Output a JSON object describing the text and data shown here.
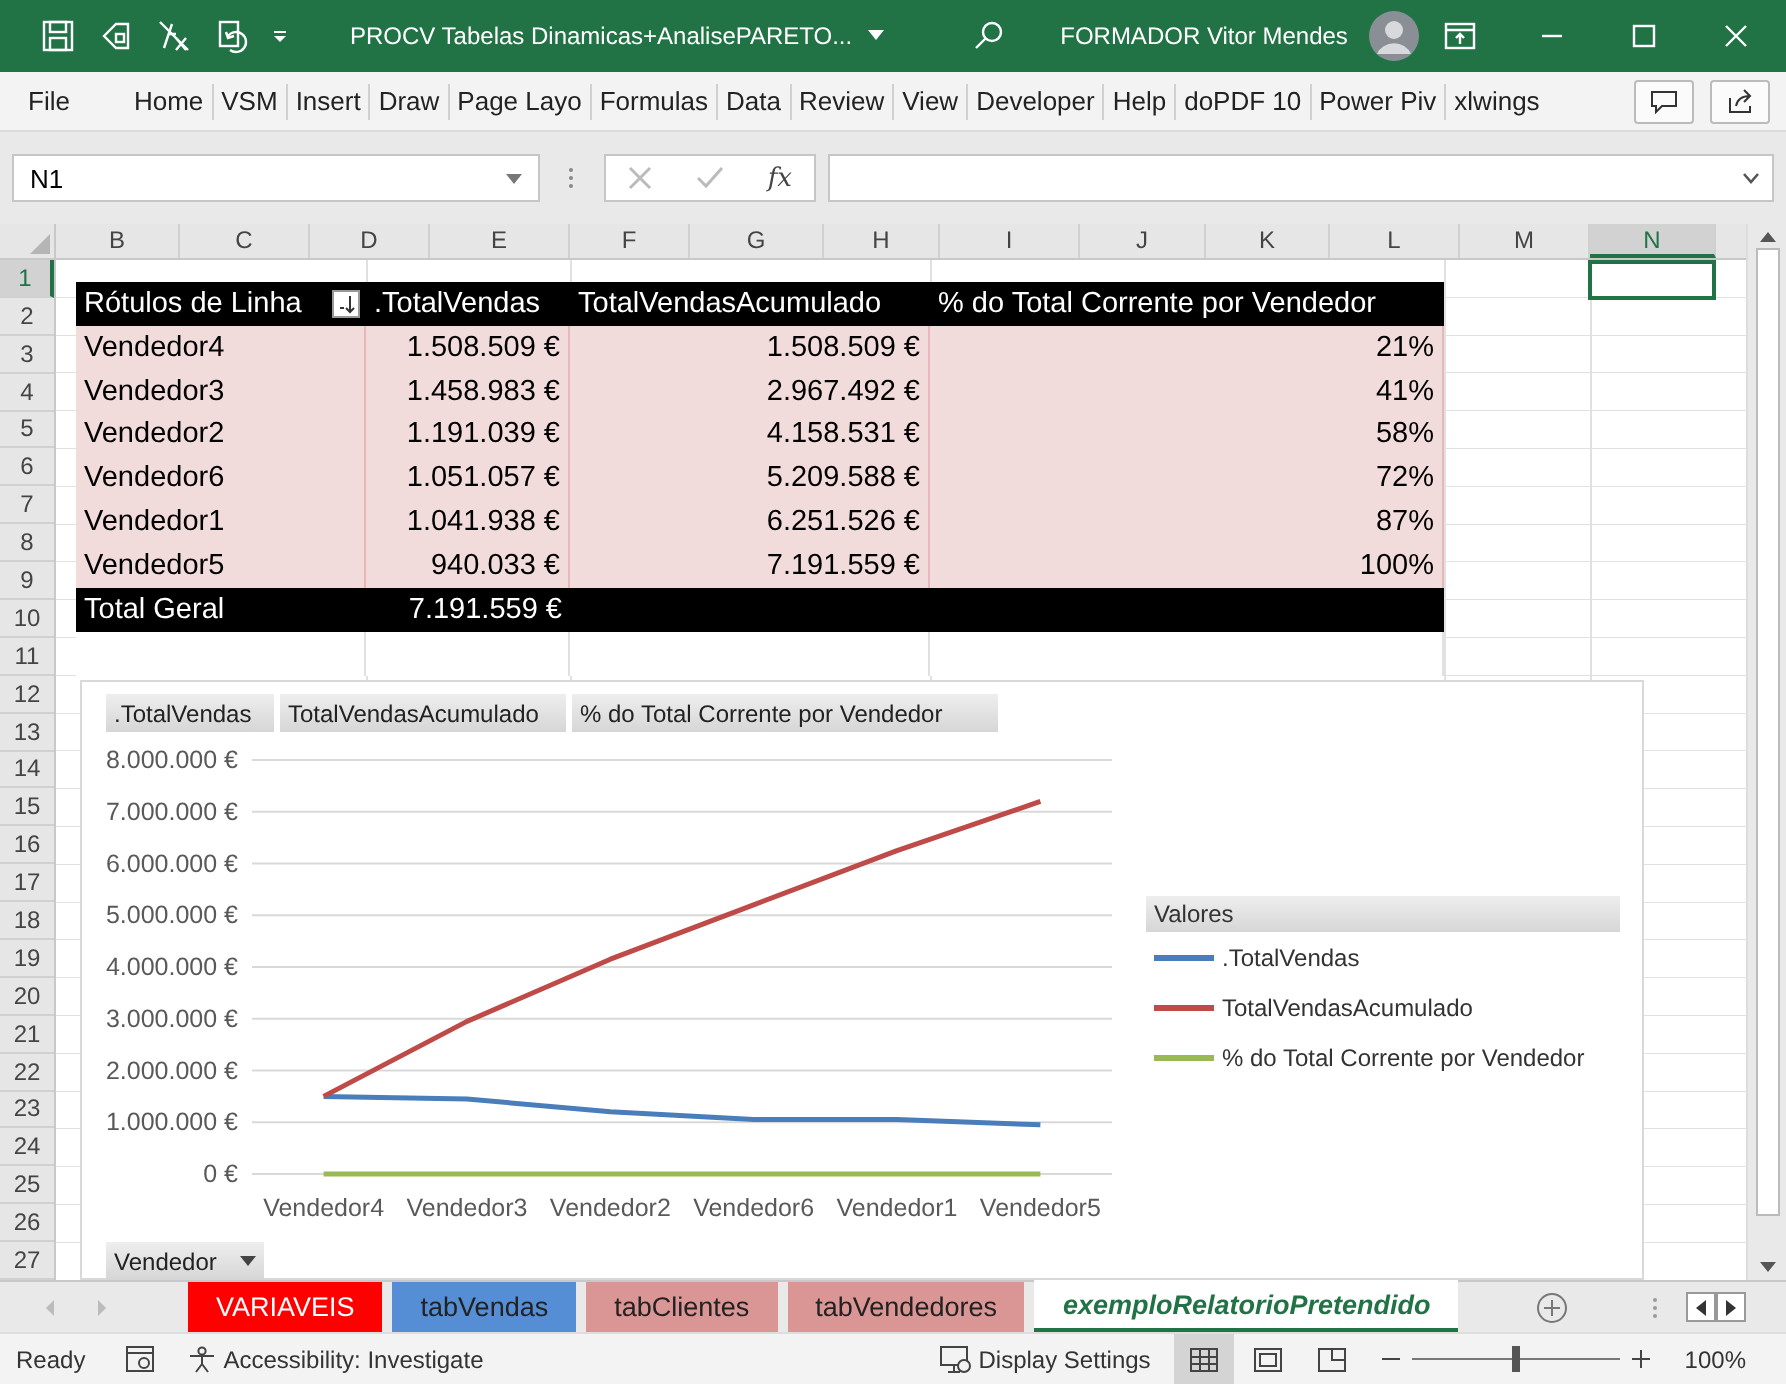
{
  "title_bar": {
    "title": "PROCV Tabelas Dinamicas+AnalisePARETO...",
    "user": "FORMADOR Vitor Mendes"
  },
  "ribbon_tabs": [
    "File",
    "Home",
    "VSM",
    "Insert",
    "Draw",
    "Page Layo",
    "Formulas",
    "Data",
    "Review",
    "View",
    "Developer",
    "Help",
    "doPDF 10",
    "Power Piv",
    "xlwings"
  ],
  "formula_bar": {
    "name_box": "N1",
    "function_label": "fx"
  },
  "columns": [
    {
      "label": "B",
      "selected": false
    },
    {
      "label": "C",
      "selected": false
    },
    {
      "label": "D",
      "selected": false
    },
    {
      "label": "E",
      "selected": false
    },
    {
      "label": "F",
      "selected": false
    },
    {
      "label": "G",
      "selected": false
    },
    {
      "label": "H",
      "selected": false
    },
    {
      "label": "I",
      "selected": false
    },
    {
      "label": "J",
      "selected": false
    },
    {
      "label": "K",
      "selected": false
    },
    {
      "label": "L",
      "selected": false
    },
    {
      "label": "M",
      "selected": false
    },
    {
      "label": "N",
      "selected": true
    }
  ],
  "rows": [
    {
      "label": "1",
      "selected": true
    },
    {
      "label": "2",
      "selected": false
    },
    {
      "label": "3",
      "selected": false
    },
    {
      "label": "4",
      "selected": false
    },
    {
      "label": "5",
      "selected": false
    },
    {
      "label": "6",
      "selected": false
    },
    {
      "label": "7",
      "selected": false
    },
    {
      "label": "8",
      "selected": false
    },
    {
      "label": "9",
      "selected": false
    },
    {
      "label": "10",
      "selected": false
    },
    {
      "label": "11",
      "selected": false
    },
    {
      "label": "12",
      "selected": false
    },
    {
      "label": "13",
      "selected": false
    },
    {
      "label": "14",
      "selected": false
    },
    {
      "label": "15",
      "selected": false
    },
    {
      "label": "16",
      "selected": false
    },
    {
      "label": "17",
      "selected": false
    },
    {
      "label": "18",
      "selected": false
    },
    {
      "label": "19",
      "selected": false
    },
    {
      "label": "20",
      "selected": false
    },
    {
      "label": "21",
      "selected": false
    },
    {
      "label": "22",
      "selected": false
    },
    {
      "label": "23",
      "selected": false
    },
    {
      "label": "24",
      "selected": false
    },
    {
      "label": "25",
      "selected": false
    },
    {
      "label": "26",
      "selected": false
    },
    {
      "label": "27",
      "selected": false
    }
  ],
  "pivot_table": {
    "columns": [
      "Rótulos de Linha",
      ".TotalVendas",
      "TotalVendasAcumulado",
      "% do Total Corrente por Vendedor"
    ],
    "rows": [
      [
        "Vendedor4",
        "1.508.509 €",
        "1.508.509 €",
        "21%"
      ],
      [
        "Vendedor3",
        "1.458.983 €",
        "2.967.492 €",
        "41%"
      ],
      [
        "Vendedor2",
        "1.191.039 €",
        "4.158.531 €",
        "58%"
      ],
      [
        "Vendedor6",
        "1.051.057 €",
        "5.209.588 €",
        "72%"
      ],
      [
        "Vendedor1",
        "1.041.938 €",
        "6.251.526 €",
        "87%"
      ],
      [
        "Vendedor5",
        "940.033 €",
        "7.191.559 €",
        "100%"
      ]
    ],
    "total": [
      "Total Geral",
      "7.191.559 €"
    ]
  },
  "chart": {
    "field_buttons": [
      ".TotalVendas",
      "TotalVendasAcumulado",
      "% do Total Corrente por Vendedor"
    ],
    "legend_title": "Valores",
    "axis_field_button": "Vendedor",
    "chart_data": {
      "type": "line",
      "grid": true,
      "categories": [
        "Vendedor4",
        "Vendedor3",
        "Vendedor2",
        "Vendedor6",
        "Vendedor1",
        "Vendedor5"
      ],
      "series": [
        {
          "name": ".TotalVendas",
          "color": "#4a7ebb",
          "values": [
            1500000,
            1450000,
            1200000,
            1050000,
            1050000,
            950000
          ]
        },
        {
          "name": "TotalVendasAcumulado",
          "color": "#be4b48",
          "values": [
            1500000,
            2950000,
            4150000,
            5200000,
            6250000,
            7200000
          ]
        },
        {
          "name": "% do Total Corrente por Vendedor",
          "color": "#98b954",
          "values": [
            0,
            0,
            0,
            0,
            0,
            0
          ]
        }
      ],
      "ylim": [
        0,
        8000000
      ],
      "yticks": [
        {
          "value": 0,
          "label": "0 €"
        },
        {
          "value": 1000000,
          "label": "1.000.000 €"
        },
        {
          "value": 2000000,
          "label": "2.000.000 €"
        },
        {
          "value": 3000000,
          "label": "3.000.000 €"
        },
        {
          "value": 4000000,
          "label": "4.000.000 €"
        },
        {
          "value": 5000000,
          "label": "5.000.000 €"
        },
        {
          "value": 6000000,
          "label": "6.000.000 €"
        },
        {
          "value": 7000000,
          "label": "7.000.000 €"
        },
        {
          "value": 8000000,
          "label": "8.000.000 €"
        }
      ]
    }
  },
  "sheet_tabs": [
    {
      "label": "VARIAVEIS",
      "color": "#ff0000",
      "selected": false
    },
    {
      "label": "tabVendas",
      "color": "#558ed5",
      "selected": false
    },
    {
      "label": "tabClientes",
      "color": "#da9694",
      "selected": false
    },
    {
      "label": "tabVendedores",
      "color": "#da9694",
      "selected": false
    },
    {
      "label": "exemploRelatorioPretendido",
      "selected": true
    }
  ],
  "status_bar": {
    "ready": "Ready",
    "accessibility": "Accessibility: Investigate",
    "display_settings": "Display Settings",
    "views": [
      {
        "kind": "normal",
        "selected": true
      },
      {
        "kind": "page_layout",
        "selected": false
      },
      {
        "kind": "page_break",
        "selected": false
      }
    ],
    "zoom_slider": {
      "level": 0.5
    },
    "zoom": "100%"
  }
}
